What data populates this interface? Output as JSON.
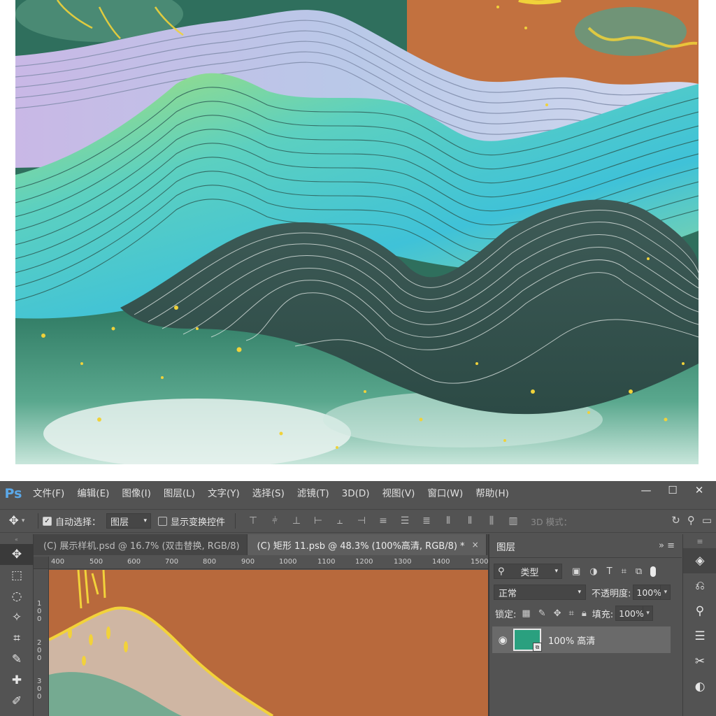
{
  "app": {
    "logo": "Ps",
    "menu": [
      "文件(F)",
      "编辑(E)",
      "图像(I)",
      "图层(L)",
      "文字(Y)",
      "选择(S)",
      "滤镜(T)",
      "3D(D)",
      "视图(V)",
      "窗口(W)",
      "帮助(H)"
    ],
    "window_controls": [
      "minimize-icon",
      "maximize-icon",
      "close-icon"
    ]
  },
  "options": {
    "auto_select_label": "自动选择：",
    "auto_select_checked": true,
    "auto_select_value": "图层",
    "show_transform_label": "显示变换控件",
    "show_transform_checked": false,
    "mode_3d": "3D 模式："
  },
  "tabs": [
    {
      "title": "(C) 展示样机.psd @ 16.7% (双击替换, RGB/8)",
      "close": "×",
      "active": false
    },
    {
      "title": "(C) 矩形 11.psb @ 48.3% (100%高清, RGB/8) *",
      "close": "×",
      "active": true
    }
  ],
  "ruler": {
    "h_ticks": [
      "400",
      "500",
      "600",
      "700",
      "800",
      "900",
      "1000",
      "1100",
      "1200",
      "1300",
      "1400",
      "1500"
    ],
    "v_ticks": [
      "100",
      "200",
      "300"
    ]
  },
  "layers_panel": {
    "title": "图层",
    "collapse_glyph": "»",
    "filter_kind": "类型",
    "blend_mode": "正常",
    "opacity_label": "不透明度:",
    "opacity_value": "100%",
    "lock_label": "锁定:",
    "fill_label": "填充:",
    "fill_value": "100%",
    "layers": [
      {
        "name": "100% 高清",
        "visible": true,
        "thumb_color": "#2aa07f"
      }
    ]
  },
  "colors": {
    "ui_bg": "#535353",
    "canvas_bg": "#b8693c",
    "accent_gold": "#f0d23a",
    "ps_blue": "#5ba8e8"
  }
}
